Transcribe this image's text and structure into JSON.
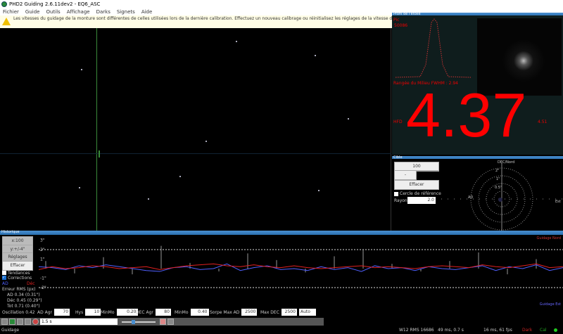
{
  "window": {
    "title": "PHD2 Guiding 2.6.11dev2 - EQ6_ASC"
  },
  "menu": [
    "Fichier",
    "Guide",
    "Outils",
    "Affichage",
    "Darks",
    "Signets",
    "Aide"
  ],
  "warning": {
    "icon": "warning-icon",
    "text": "Les vitesses du guidage de la monture sont différentes de celles utilisées lors de la dernière calibration. Effectuez un nouveau calibrage ou réinitialisez les réglages de la vitesse de guidage aux valeurs précédentes"
  },
  "profile": {
    "title": "Profil de l'étoile",
    "label_top": "Pic",
    "peak": "50086",
    "fwhm_label": "Rangée du Milieu FWHM : 2.94",
    "hfd_label": "HFD",
    "hfd": "4.37",
    "snr": "4.51"
  },
  "target": {
    "title": "Cible",
    "zoom_btn": "100",
    "minus_btn": "-",
    "clear_btn": "Effacer",
    "ref_circle": "Cercle de référence",
    "radius_label": "Rayons",
    "radius_value": "2.0",
    "scale_labels": [
      "2\"",
      "1\"",
      "0.5\""
    ],
    "axis_labels": [
      "DEC/Nord",
      "AD",
      "Est"
    ]
  },
  "history": {
    "title": "Historique",
    "btn_scale": "x:100",
    "btn_y": "y:+/-4\"",
    "btn_settings": "Réglages",
    "btn_clear": "Effacer",
    "trendlines": "Tendances",
    "corrections": "Corrections",
    "corrections_checked": true,
    "legend_ra": "AD",
    "legend_dec": "Déc",
    "rms_label": "Erreur RMS (px)",
    "rms_ra": "AD 0.34 (0.31\")",
    "rms_dec": "Déc 0.45 (0.29\")",
    "rms_tot": "Tot 0.71 (0.40\")",
    "osc": "Oscillation 0.42",
    "yticks": [
      "3\"",
      "2\"",
      "1\"",
      "-1\"",
      "-2\""
    ],
    "right_top": "Guidage Nord",
    "right_bottom": "Guidage Est",
    "colors": {
      "ra": "#5060ff",
      "dec": "#e02020",
      "grid": "#ddd"
    },
    "ra": [
      0.2,
      0.1,
      -0.1,
      0.3,
      0.1,
      0.4,
      0.2,
      0.0,
      -0.2,
      -0.3,
      0.1,
      0.2,
      -0.1,
      0.0,
      0.5,
      -0.2,
      0.1,
      0.3,
      -0.1,
      0.0,
      -0.2,
      0.2,
      -0.1,
      0.1,
      -0.3,
      0.3,
      0.0,
      0.1,
      -0.2,
      0.2,
      0.0,
      -0.1,
      0.1,
      0.3,
      -0.2,
      0.2,
      0.0,
      0.4,
      -0.2,
      0.1
    ],
    "dec": [
      -0.1,
      0.2,
      0.0,
      0.1,
      0.3,
      0.2,
      0.0,
      0.1,
      0.2,
      -0.1,
      0.1,
      0.3,
      0.4,
      0.5,
      0.3,
      0.2,
      0.4,
      0.2,
      0.1,
      0.3,
      0.1,
      0.0,
      0.1,
      0.2,
      0.3,
      0.1,
      0.2,
      0.1,
      0.0,
      0.2,
      0.3,
      0.2,
      0.1,
      0.4,
      0.2,
      0.1,
      0.3,
      0.5,
      0.1,
      0.2
    ],
    "pulses": [
      0.8,
      -0.5,
      1.2,
      -0.6,
      2.4,
      0.6,
      -0.3,
      1.6,
      0.9,
      -0.4,
      1.3,
      2.0,
      0.5,
      -0.3,
      0.8,
      1.7,
      -0.6,
      1.0
    ]
  },
  "controls": [
    {
      "label": "AD Agr",
      "value": "70"
    },
    {
      "label": "Hys",
      "value": "10"
    },
    {
      "label": "MinMo",
      "value": "0.20"
    },
    {
      "label": "DEC Agr",
      "value": "80"
    },
    {
      "label": "MinMo",
      "value": "0.40"
    },
    {
      "label": "Sorpe Max AD",
      "value": "2500"
    },
    {
      "label": "Max DEC",
      "value": "2500"
    }
  ],
  "dec_mode": "Auto",
  "toolbar": {
    "exposure": "1.5 s"
  },
  "status": {
    "left": "Guidage",
    "cam": "W12 RMS 16686",
    "timing": "49 ms, 0.7 s",
    "fps": "16 ms, 61 fps",
    "dark": "Dark",
    "cal": "Cal"
  }
}
